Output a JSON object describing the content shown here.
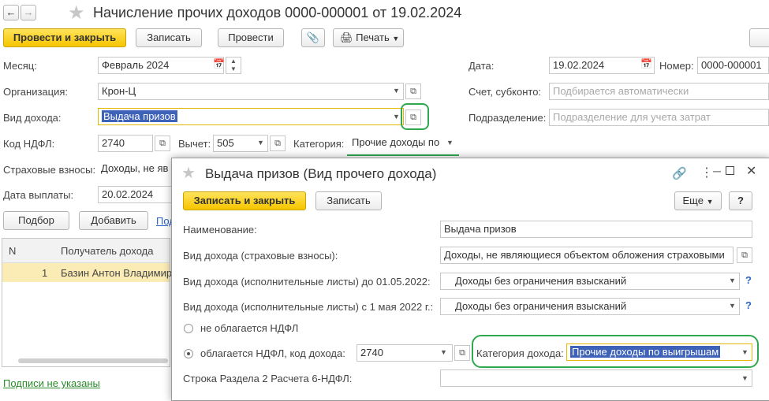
{
  "window": {
    "title": "Начисление прочих доходов 0000-000001 от 19.02.2024"
  },
  "toolbar": {
    "post_close": "Провести и закрыть",
    "save": "Записать",
    "post": "Провести",
    "print": "Печать"
  },
  "form": {
    "month_label": "Месяц:",
    "month_value": "Февраль 2024",
    "org_label": "Организация:",
    "org_value": "Крон-Ц",
    "income_label": "Вид дохода:",
    "income_value": "Выдача призов",
    "ndfl_label": "Код НДФЛ:",
    "ndfl_value": "2740",
    "deduction_label": "Вычет:",
    "deduction_value": "505",
    "category_label": "Категория:",
    "category_value": "Прочие доходы по",
    "insurance_label": "Страховые взносы:",
    "insurance_value": "Доходы, не яв",
    "paydate_label": "Дата выплаты:",
    "paydate_value": "20.02.2024",
    "date_label": "Дата:",
    "date_value": "19.02.2024",
    "number_label": "Номер:",
    "number_value": "0000-000001",
    "account_label": "Счет, субконто:",
    "account_placeholder": "Подбирается автоматически",
    "division_label": "Подразделение:",
    "division_placeholder": "Подразделение для учета затрат"
  },
  "table": {
    "select_btn": "Подбор",
    "add_btn": "Добавить",
    "more_link": "Под",
    "col_n": "N",
    "col_recipient": "Получатель дохода",
    "rows": [
      {
        "n": "1",
        "recipient": "Базин Антон Владимир"
      }
    ]
  },
  "footer": {
    "signatures_link": "Подписи не указаны"
  },
  "dialog": {
    "title": "Выдача призов (Вид прочего дохода)",
    "save_close": "Записать и закрыть",
    "save": "Записать",
    "more": "Еще",
    "help": "?",
    "name_label": "Наименование:",
    "name_value": "Выдача призов",
    "ins_label": "Вид дохода (страховые взносы):",
    "ins_value": "Доходы, не являющиеся объектом обложения страховыми",
    "exec1_label": "Вид дохода (исполнительные листы) до 01.05.2022:",
    "exec1_value": "Доходы без ограничения взысканий",
    "exec2_label": "Вид дохода (исполнительные листы) с 1 мая 2022 г.:",
    "exec2_value": "Доходы без ограничения взысканий",
    "no_ndfl": "не облагается НДФЛ",
    "ndfl_code_label": "облагается НДФЛ, код дохода:",
    "ndfl_code_value": "2740",
    "category_label": "Категория дохода:",
    "category_value": "Прочие доходы по выигрышам",
    "row6_label": "Строка Раздела 2 Расчета 6-НДФЛ:",
    "row6_value": ""
  }
}
